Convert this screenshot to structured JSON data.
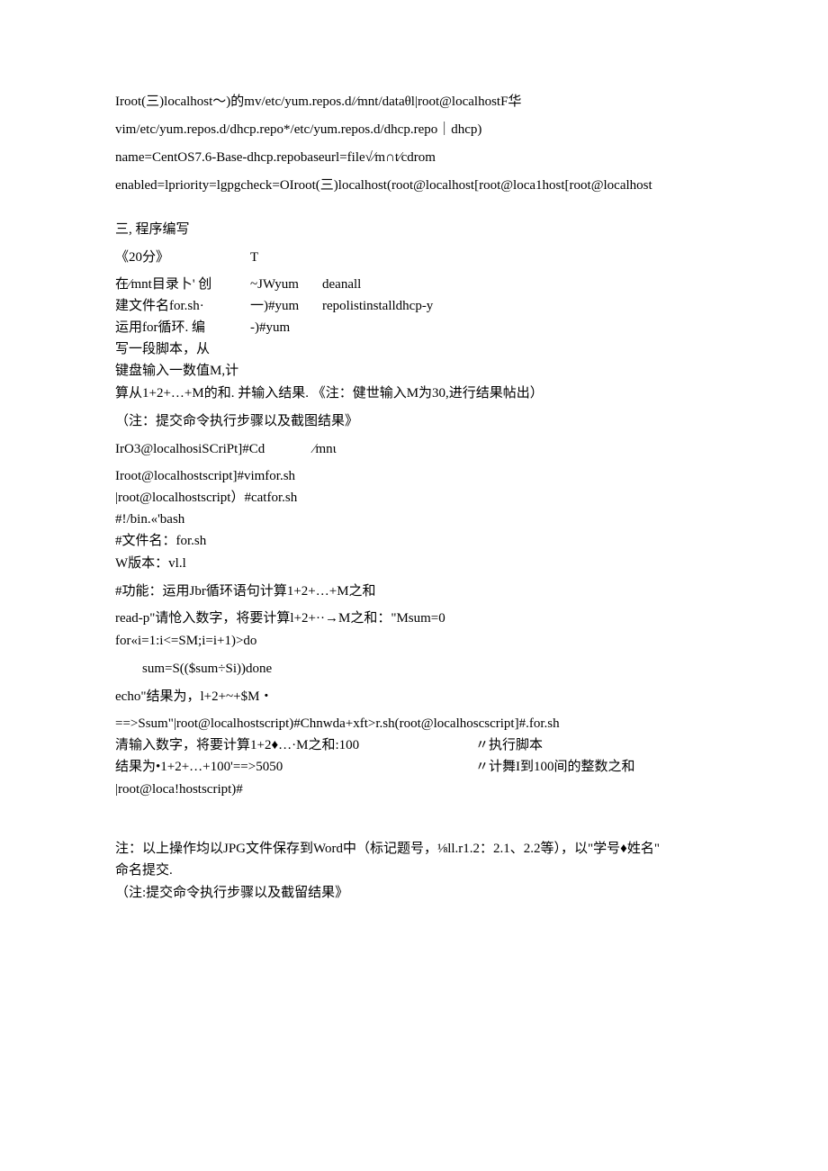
{
  "p1": "Iroot(三)localhost〜)的mv/etc/yum.repos.d/∕mnt/dataθl|root@localhostF华",
  "p2": "vim/etc/yum.repos.d/dhcp.repo*/etc/yum.repos.d/dhcp.repo｜dhcp)",
  "p3": "name=CentOS7.6-Base-dhcp.repobaseurl=file√∕m∩t∕cdrom",
  "p4": "enabled=lpriority=lgpgcheck=OIroot(三)localhost(root@localhost[root@loca1host[root@localhost",
  "section_title": "三, 程序编写",
  "score": "《20分》",
  "t_mark": "T",
  "left1": "在∕mnt目录卜' 创",
  "left2": "建文件名for.sh·",
  "left3": "运用for循环. 编",
  "left4": "写一段脚本，从",
  "left5": "键盘输入一数值M,计",
  "mid1": "~JWyum",
  "mid2": "一)#yum",
  "mid3": "-)#yum",
  "right1": "deanall",
  "right2": "repolistinstalldhcp-y",
  "l6": "算从1+2+…+M的和. 并输入结果. 《注：健世输入M为30,进行结果帖出）",
  "l7": "（注：提交命令执行步骤以及截图结果》",
  "l8a": "IrO3@localhosiSCriPt]#Cd",
  "l8b": "∕mnι",
  "l9": "Iroot@localhostscript]#vimfor.sh",
  "l10": "|root@localhostscript）#catfor.sh",
  "l11": "#!/bin.«'bash",
  "l12": "#文件名：for.sh",
  "l13": "W版本：vl.l",
  "l14": "#功能：运用Jbr循环语句计算1+2+…+M之和",
  "l15": "read-p\"请怆入数字，将要计算l+2+··→M之和：\"Msum=0",
  "l16": "for«i=1:i<=SM;i=i+1)>do",
  "l17": "sum=S(($sum÷Si))done",
  "l18": "echo\"结果为，l+2+~+$M・",
  "l19": "==>Ssum\"|root@localhostscript)#Chnwda+xft>r.sh(root@localhoscscript]#.for.sh",
  "note1_left": "清输入数字，将要计算1+2♦…·M之和:100",
  "note1_right": "〃执行脚本",
  "note2_left": "结果为•1+2+…+100'==>5050",
  "note2_right": "〃计舞I到100间的整数之和",
  "l22": "|root@loca!hostscript)#",
  "l23": "注：以上操作均以JPG文件保存到Word中（标记题号，⅛ll.r1.2：2.1、2.2等），以\"学号♦姓名\"",
  "l24": "命名提交.",
  "l25": "（注:提交命令执行步骤以及截留结果》"
}
